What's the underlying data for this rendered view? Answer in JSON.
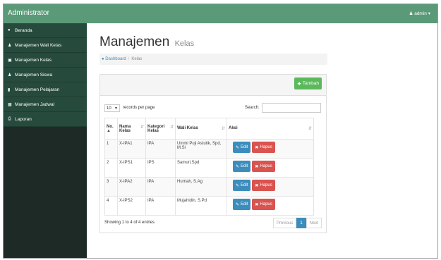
{
  "topbar": {
    "brand": "Administrator",
    "user": "admin",
    "user_icon": "user-icon"
  },
  "sidebar": {
    "items": [
      {
        "label": "Beranda",
        "icon": "dashboard-icon"
      },
      {
        "label": "Manajemen Wali Kelas",
        "icon": "user-icon"
      },
      {
        "label": "Manajemen Kelas",
        "icon": "table-icon"
      },
      {
        "label": "Manajemen Siswa",
        "icon": "users-icon"
      },
      {
        "label": "Manajemen Pelajaran",
        "icon": "book-icon"
      },
      {
        "label": "Manajemen Jadwal",
        "icon": "calendar-icon"
      },
      {
        "label": "Laporan",
        "icon": "print-icon"
      }
    ]
  },
  "page": {
    "title": "Manajemen",
    "subtitle": "Kelas"
  },
  "breadcrumb": {
    "home": "Dashboard",
    "separator": "/",
    "current": "Kelas"
  },
  "toolbar": {
    "add_label": "Tambah"
  },
  "table_controls": {
    "page_size": "10",
    "records_label": "records per page",
    "search_label": "Search:",
    "search_value": ""
  },
  "table": {
    "headers": [
      "No.",
      "Nama Kelas",
      "Kategori Kelas",
      "Wali Kelas",
      "Aksi"
    ],
    "rows": [
      {
        "no": "1",
        "nama": "X-IPA1",
        "kategori": "IPA",
        "wali": "Ummi Puji Astutik, Spd, M.Si"
      },
      {
        "no": "2",
        "nama": "X-IPS1",
        "kategori": "IPS",
        "wali": "Samuri,Spd"
      },
      {
        "no": "3",
        "nama": "X-IPA2",
        "kategori": "IPA",
        "wali": "Hurriah, S.Ag"
      },
      {
        "no": "4",
        "nama": "X-IPS2",
        "kategori": "IPA",
        "wali": "Mujahidin, S.Pd"
      }
    ],
    "edit_label": "Edit",
    "delete_label": "Hapus"
  },
  "footer": {
    "info": "Showing 1 to 4 of 4 entries",
    "previous": "Previous",
    "current_page": "1",
    "next": "Next"
  },
  "colors": {
    "topbar": "#5b9a78",
    "sidebar_item": "#264a3c",
    "add": "#5cb85c",
    "edit": "#3c8dbc",
    "delete": "#d9534f"
  }
}
